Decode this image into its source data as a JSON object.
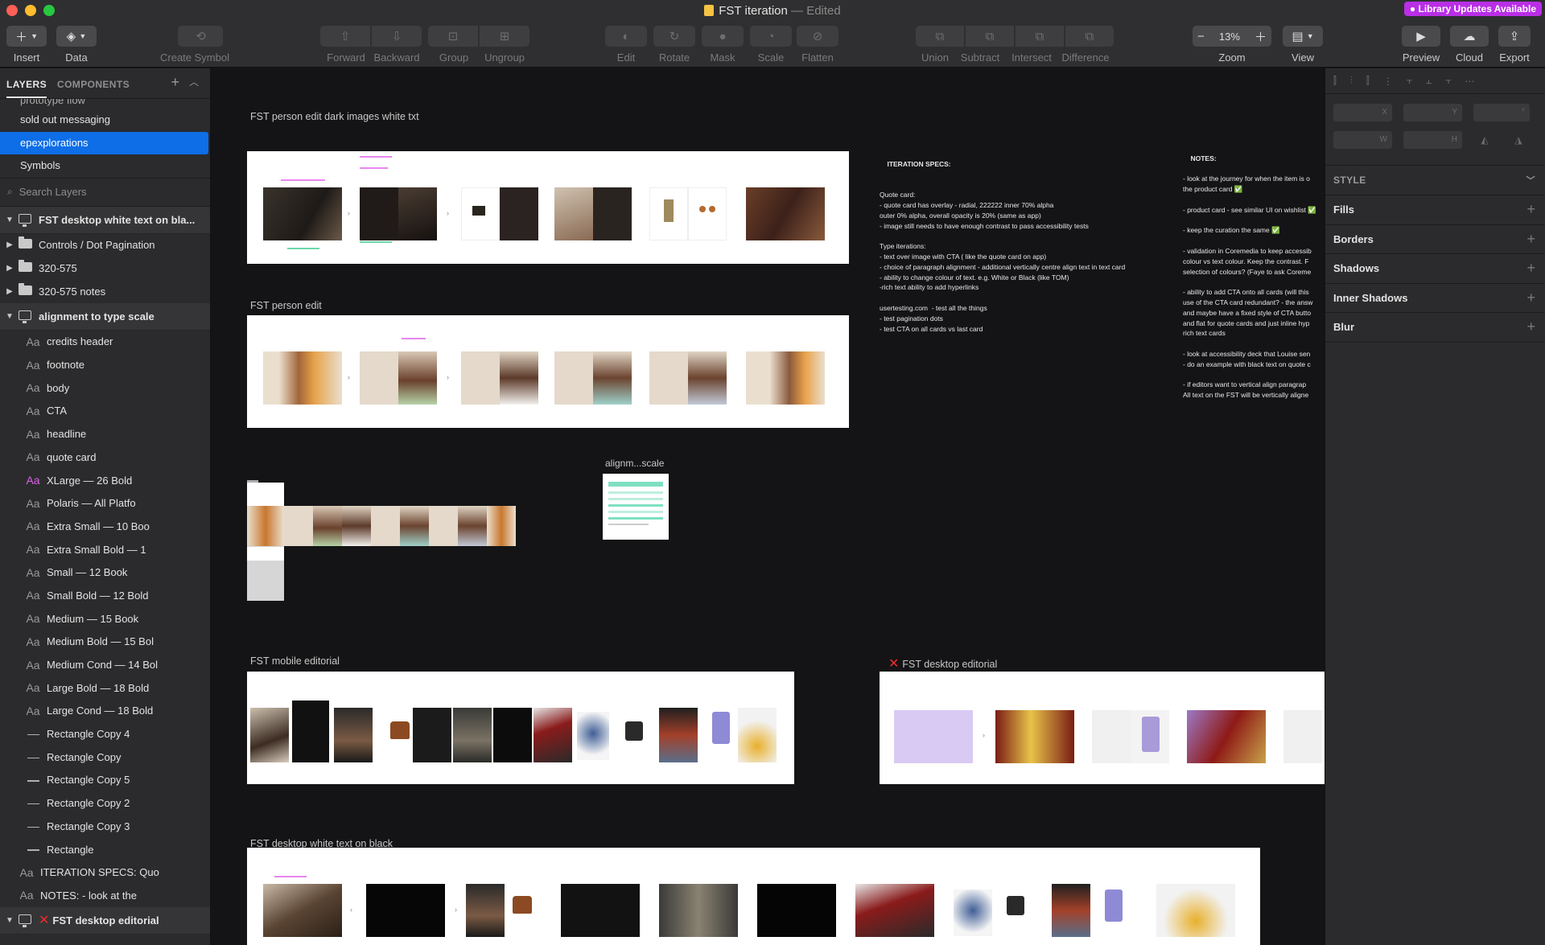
{
  "window": {
    "title": "FST iteration",
    "edited": "— Edited",
    "library_updates": "● Library Updates Available"
  },
  "toolbar": {
    "insert": "Insert",
    "data": "Data",
    "create_symbol": "Create Symbol",
    "forward": "Forward",
    "backward": "Backward",
    "group": "Group",
    "ungroup": "Ungroup",
    "edit": "Edit",
    "rotate": "Rotate",
    "mask": "Mask",
    "scale": "Scale",
    "flatten": "Flatten",
    "union": "Union",
    "subtract": "Subtract",
    "intersect": "Intersect",
    "difference": "Difference",
    "zoom_label": "Zoom",
    "zoom_value": "13%",
    "view": "View",
    "preview": "Preview",
    "cloud": "Cloud",
    "export": "Export"
  },
  "left_panel": {
    "tab_layers": "LAYERS",
    "tab_components": "COMPONENTS",
    "pages": [
      "prototype flow",
      "sold out messaging",
      "epexplorations",
      "Symbols"
    ],
    "selected_page": "epexplorations",
    "search_placeholder": "Search Layers",
    "layers": [
      {
        "name": "FST desktop white text on bla...",
        "kind": "artboard",
        "group": true
      },
      {
        "name": "Controls / Dot Pagination",
        "kind": "folder"
      },
      {
        "name": "320-575",
        "kind": "folder"
      },
      {
        "name": "320-575 notes",
        "kind": "folder"
      },
      {
        "name": "alignment to type scale",
        "kind": "artboard",
        "group": true
      },
      {
        "name": "credits header",
        "kind": "text"
      },
      {
        "name": "footnote",
        "kind": "text"
      },
      {
        "name": "body",
        "kind": "text"
      },
      {
        "name": "CTA",
        "kind": "text"
      },
      {
        "name": "headline",
        "kind": "text"
      },
      {
        "name": "quote card",
        "kind": "text"
      },
      {
        "name": "XLarge — 26 Bold",
        "kind": "text-pink"
      },
      {
        "name": "Polaris — All Platfo",
        "kind": "text"
      },
      {
        "name": "Extra Small — 10 Boo",
        "kind": "text"
      },
      {
        "name": "Extra Small Bold — 1",
        "kind": "text"
      },
      {
        "name": "Small — 12 Book",
        "kind": "text"
      },
      {
        "name": "Small Bold — 12 Bold",
        "kind": "text"
      },
      {
        "name": "Medium — 15 Book",
        "kind": "text"
      },
      {
        "name": "Medium Bold — 15 Bol",
        "kind": "text"
      },
      {
        "name": "Medium Cond — 14 Bol",
        "kind": "text"
      },
      {
        "name": "Large Bold — 18 Bold",
        "kind": "text"
      },
      {
        "name": "Large Cond — 18 Bold",
        "kind": "text"
      },
      {
        "name": "Rectangle Copy 4",
        "kind": "rect"
      },
      {
        "name": "Rectangle Copy",
        "kind": "rect"
      },
      {
        "name": "Rectangle Copy 5",
        "kind": "rect"
      },
      {
        "name": "Rectangle Copy 2",
        "kind": "rect"
      },
      {
        "name": "Rectangle Copy 3",
        "kind": "rect"
      },
      {
        "name": "Rectangle",
        "kind": "rect"
      },
      {
        "name": "ITERATION SPECS: Quo",
        "kind": "text-root"
      },
      {
        "name": "NOTES: - look at the",
        "kind": "text-root"
      },
      {
        "name": "FST desktop editorial",
        "kind": "artboard-x",
        "group": true
      }
    ]
  },
  "inspector": {
    "x": "X",
    "y": "Y",
    "rotation": "°",
    "w": "W",
    "h": "H",
    "style": "STYLE",
    "rows": [
      "Fills",
      "Borders",
      "Shadows",
      "Inner Shadows",
      "Blur"
    ]
  },
  "canvas": {
    "artboards": {
      "dark_images": "FST person edit  dark images white txt",
      "person_edit": "FST person edit",
      "alignment": "alignm...scale",
      "mobile_editorial": "FST mobile editorial",
      "desktop_editorial": "FST desktop editorial",
      "white_on_black": "FST desktop white text on black"
    },
    "specs_title": "ITERATION SPECS:",
    "specs_lines": [
      "",
      "Quote card:",
      "- quote card has overlay - radial, 222222 inner 70% alpha",
      "outer 0% alpha, overall opacity is 20% (same as app)",
      "- image still needs to have enough contrast to pass accessibility tests",
      "",
      "Type iterations:",
      "- text over image with CTA ( like the quote card on app)",
      "- choice of paragraph alignment - additional vertically centre align text in text card",
      "- ability to change colour of text. e.g. White or Black (like TOM)",
      "-rich text ability to add hyperlinks",
      "",
      "usertesting.com  - test all the things",
      "- test pagination dots",
      "- test CTA on all cards vs last card"
    ],
    "notes_title": "NOTES:",
    "notes_lines": [
      "- look at the journey for when the item is o",
      "the product card ✅",
      "",
      "- product card - see similar UI on wishlist ✅",
      "",
      "- keep the curation the same ✅",
      "",
      "- validation in Coremedia to keep accessib",
      "colour vs text colour. Keep the contrast. F",
      "selection of colours? (Faye to ask Coreme",
      "",
      "- ability to add CTA onto all cards (will this",
      "use of the CTA card redundant? - the answ",
      "and maybe have a fixed style of CTA butto",
      "and flat for quote cards and just inline hyp",
      "rich text cards",
      "",
      "- look at accessibility deck that Louise sen",
      "- do an example with black text on quote c",
      "",
      "- if editors want to vertical align paragrap",
      "All text on the FST will be vertically aligne"
    ]
  }
}
